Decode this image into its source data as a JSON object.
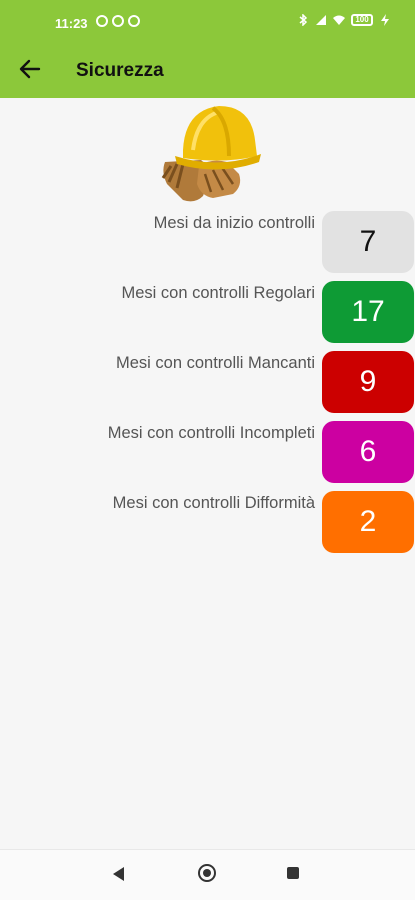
{
  "status_bar": {
    "time": "11:23",
    "battery": "100"
  },
  "app_bar": {
    "title": "Sicurezza",
    "back_icon": "arrow-left-icon",
    "color": "#8cc83a"
  },
  "hero_image": "hard-hat-and-gloves",
  "stats": [
    {
      "label": "Mesi da inizio controlli",
      "value": "7",
      "color": "#e2e2e2",
      "text_color": "#111111"
    },
    {
      "label": "Mesi con controlli Regolari",
      "value": "17",
      "color": "#0e9b35",
      "text_color": "#ffffff"
    },
    {
      "label": "Mesi con controlli Mancanti",
      "value": "9",
      "color": "#cc0000",
      "text_color": "#ffffff"
    },
    {
      "label": "Mesi con controlli Incompleti",
      "value": "6",
      "color": "#cc00a1",
      "text_color": "#ffffff"
    },
    {
      "label": "Mesi con controlli Difformità",
      "value": "2",
      "color": "#ff6f00",
      "text_color": "#ffffff"
    }
  ],
  "nav_bar": {
    "back": "nav-back-icon",
    "home": "nav-home-icon",
    "recents": "nav-recents-icon"
  }
}
